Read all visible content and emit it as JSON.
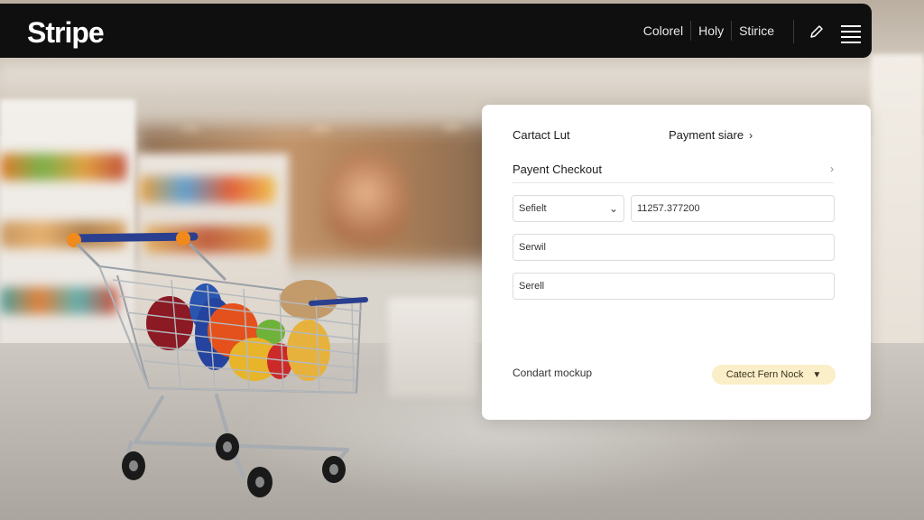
{
  "header": {
    "brand": "Stripe",
    "nav": [
      "Colorel",
      "Holy",
      "Stirice"
    ],
    "tool_icon": "pen-icon",
    "menu_icon": "hamburger-menu-icon"
  },
  "card": {
    "head_left": "Cartact Lut",
    "head_right": "Payment siare",
    "head_right_icon": "chevron-right-icon",
    "section_title": "Payent Checkout",
    "section_icon": "chevron-right-icon",
    "select_value": "Sefielt",
    "number_value": "11257.377200",
    "field2_value": "Serwil",
    "field3_value": "Serell",
    "footer_label": "Condart mockup",
    "footer_button": "Catect Fern Nock"
  },
  "colors": {
    "topbar": "#0f0f10",
    "card": "#ffffff",
    "button": "#fbefc9",
    "cart_handle": "#2a3f8f",
    "cart_handle_accent": "#f08a1c"
  }
}
